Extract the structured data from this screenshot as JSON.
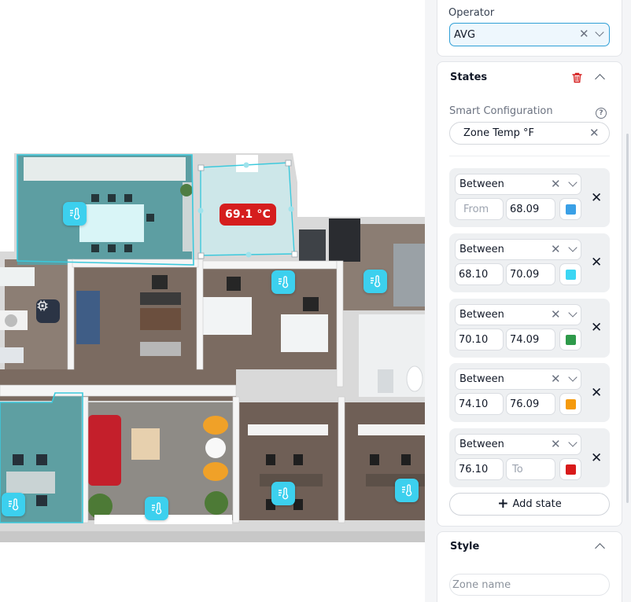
{
  "colors": {
    "accent": "#2f9fd6",
    "sensor": "#3cd0ee",
    "alert": "#d51e1e",
    "delete": "#d51e1e"
  },
  "floorplan": {
    "temperature_badge": "69.1 °C",
    "sensor_icon": "thermometer-icon",
    "device_icon": "chip-icon"
  },
  "operator": {
    "label": "Operator",
    "value": "AVG"
  },
  "states": {
    "title": "States",
    "smart_config_label": "Smart Configuration",
    "smart_config_value": "Zone Temp °F",
    "items": [
      {
        "operator": "Between",
        "from": "",
        "from_placeholder": "From",
        "to": "68.09",
        "to_placeholder": "",
        "color": "#3aa0e6"
      },
      {
        "operator": "Between",
        "from": "68.10",
        "from_placeholder": "",
        "to": "70.09",
        "to_placeholder": "",
        "color": "#3cd6f3"
      },
      {
        "operator": "Between",
        "from": "70.10",
        "from_placeholder": "",
        "to": "74.09",
        "to_placeholder": "",
        "color": "#2e9a4a"
      },
      {
        "operator": "Between",
        "from": "74.10",
        "from_placeholder": "",
        "to": "76.09",
        "to_placeholder": "",
        "color": "#f59a0c"
      },
      {
        "operator": "Between",
        "from": "76.10",
        "from_placeholder": "",
        "to": "",
        "to_placeholder": "To",
        "color": "#d81a1a"
      }
    ],
    "add_label": "Add state"
  },
  "style": {
    "title": "Style",
    "zone_name_placeholder": "Zone name"
  }
}
